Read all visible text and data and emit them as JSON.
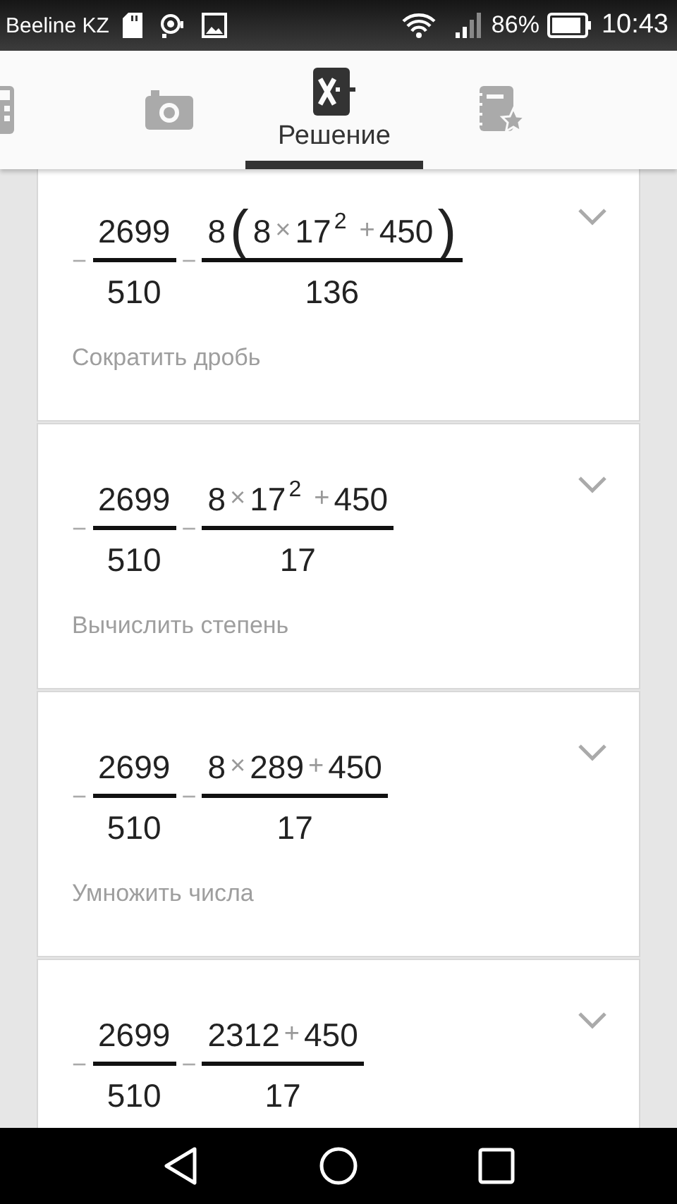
{
  "status_bar": {
    "carrier": "Beeline KZ",
    "battery_text": "86%",
    "time": "10:43"
  },
  "tabs": [
    {
      "kind": "calculator",
      "selected": false
    },
    {
      "kind": "camera",
      "selected": false
    },
    {
      "kind": "solution",
      "label": "Решение",
      "selected": true
    },
    {
      "kind": "notebook",
      "selected": false
    }
  ],
  "steps": [
    {
      "sign": "−",
      "first": {
        "num": "2699",
        "den": "510"
      },
      "op": "−",
      "second": {
        "num": [
          {
            "kind": "text",
            "t": "8"
          },
          {
            "kind": "paren",
            "t": "("
          },
          {
            "kind": "text",
            "t": "8"
          },
          {
            "kind": "op",
            "t": "×"
          },
          {
            "kind": "text",
            "t": "17"
          },
          {
            "kind": "sup",
            "t": "2"
          },
          {
            "kind": "op",
            "t": "+"
          },
          {
            "kind": "text",
            "t": "450"
          },
          {
            "kind": "paren",
            "t": ")"
          }
        ],
        "den": "136"
      },
      "description": "Сократить дробь"
    },
    {
      "sign": "−",
      "first": {
        "num": "2699",
        "den": "510"
      },
      "op": "−",
      "second": {
        "num": [
          {
            "kind": "text",
            "t": "8"
          },
          {
            "kind": "op",
            "t": "×"
          },
          {
            "kind": "text",
            "t": "17"
          },
          {
            "kind": "sup",
            "t": "2"
          },
          {
            "kind": "op",
            "t": "+"
          },
          {
            "kind": "text",
            "t": "450"
          }
        ],
        "den": "17"
      },
      "description": "Вычислить степень"
    },
    {
      "sign": "−",
      "first": {
        "num": "2699",
        "den": "510"
      },
      "op": "−",
      "second": {
        "num": [
          {
            "kind": "text",
            "t": "8"
          },
          {
            "kind": "op",
            "t": "×"
          },
          {
            "kind": "text",
            "t": "289"
          },
          {
            "kind": "op",
            "t": "+"
          },
          {
            "kind": "text",
            "t": "450"
          }
        ],
        "den": "17"
      },
      "description": "Умножить числа"
    },
    {
      "sign": "−",
      "first": {
        "num": "2699",
        "den": "510"
      },
      "op": "−",
      "second": {
        "num": [
          {
            "kind": "text",
            "t": "2312"
          },
          {
            "kind": "op",
            "t": "+"
          },
          {
            "kind": "text",
            "t": "450"
          }
        ],
        "den": "17"
      }
    }
  ]
}
